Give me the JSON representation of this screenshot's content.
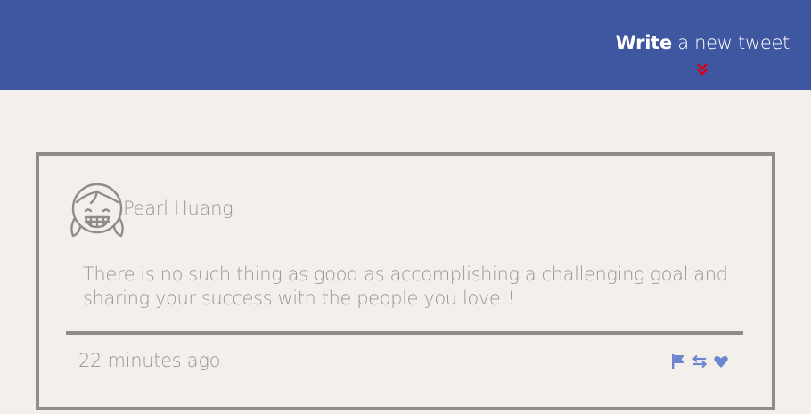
{
  "header": {
    "compose": {
      "strong": "Write",
      "rest": " a new tweet"
    },
    "colors": {
      "background": "#3f56a0",
      "arrow": "#d0021b"
    }
  },
  "tweet": {
    "author": "Pearl Huang",
    "avatar_icon": "smiling-girl-avatar-icon",
    "text": "There is no such thing as good as accomplishing a challenging goal and sharing your success with the people you love!!",
    "timestamp": "22 minutes ago",
    "actions": [
      {
        "name": "flag-icon"
      },
      {
        "name": "retweet-icon"
      },
      {
        "name": "heart-icon"
      }
    ],
    "colors": {
      "text": "#9a9794",
      "border": "#8f8c89",
      "action": "#6d87cf"
    }
  }
}
